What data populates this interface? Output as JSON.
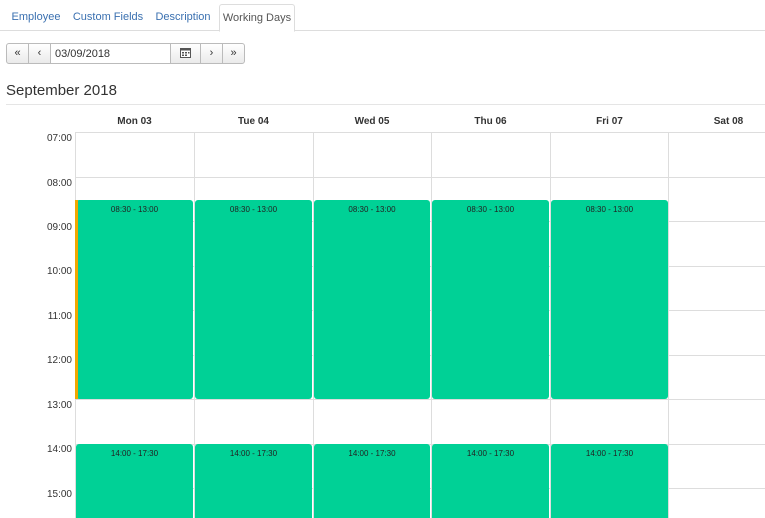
{
  "tabs": [
    {
      "label": "Employee"
    },
    {
      "label": "Custom Fields"
    },
    {
      "label": "Description"
    },
    {
      "label": "Working Days"
    }
  ],
  "toolbar": {
    "first_label": "«",
    "prev_label": "‹",
    "date_value": "03/09/2018",
    "calendar_icon": "calendar-icon",
    "next_label": "›",
    "last_label": "»"
  },
  "month_title": "September 2018",
  "days": [
    "Mon 03",
    "Tue 04",
    "Wed 05",
    "Thu 06",
    "Fri 07",
    "Sat 08"
  ],
  "hours": [
    "07:00",
    "08:00",
    "09:00",
    "10:00",
    "11:00",
    "12:00",
    "13:00",
    "14:00",
    "15:00"
  ],
  "events": {
    "morning": [
      "08:30 - 13:00",
      "08:30 - 13:00",
      "08:30 - 13:00",
      "08:30 - 13:00",
      "08:30 - 13:00"
    ],
    "afternoon": [
      "14:00 - 17:30",
      "14:00 - 17:30",
      "14:00 - 17:30",
      "14:00 - 17:30",
      "14:00 - 17:30"
    ]
  },
  "colors": {
    "event": "#00d196",
    "accent": "#f0a800",
    "tab_link": "#3a70b0"
  }
}
